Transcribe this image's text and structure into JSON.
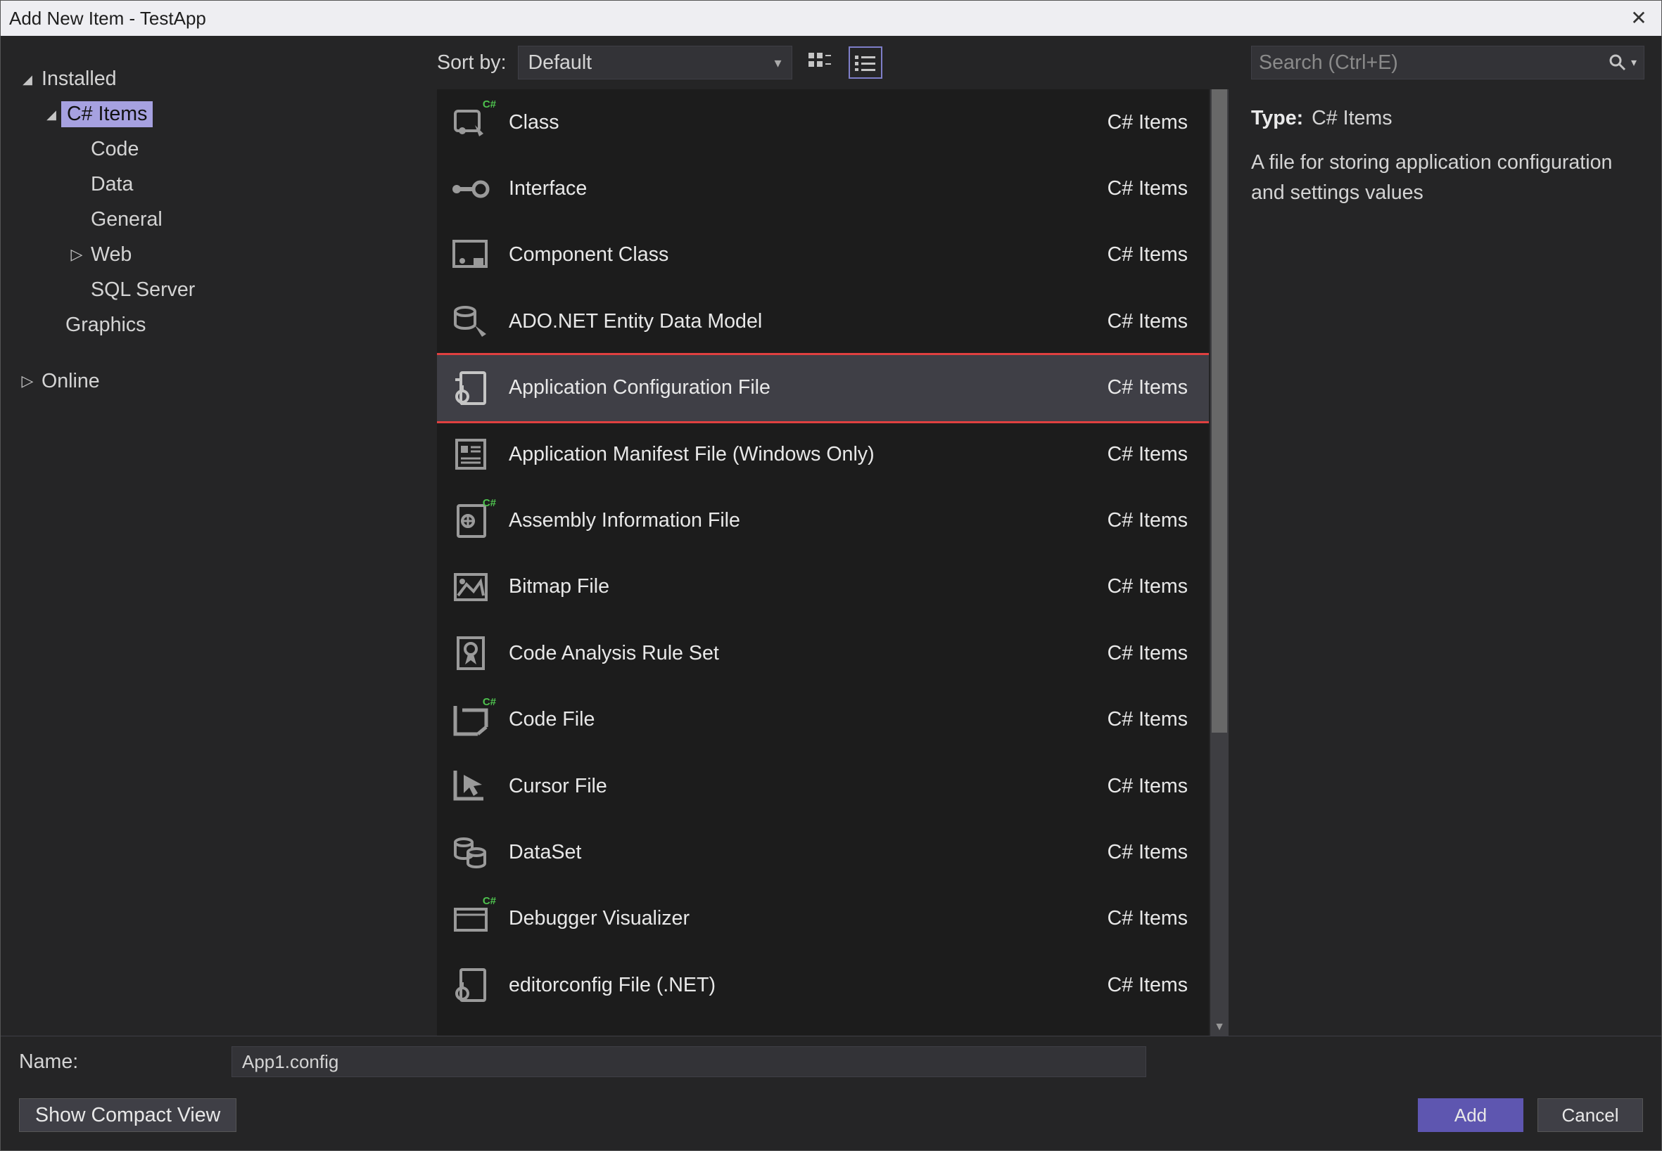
{
  "window": {
    "title": "Add New Item - TestApp"
  },
  "tree": {
    "root1": {
      "label": "Installed",
      "state": "expanded"
    },
    "csitems": {
      "label": "C# Items",
      "state": "expanded",
      "selected": true
    },
    "code": {
      "label": "Code"
    },
    "data": {
      "label": "Data"
    },
    "general": {
      "label": "General"
    },
    "web": {
      "label": "Web",
      "state": "collapsed"
    },
    "sql": {
      "label": "SQL Server"
    },
    "graphics": {
      "label": "Graphics"
    },
    "online": {
      "label": "Online",
      "state": "collapsed"
    }
  },
  "sort": {
    "label": "Sort by:",
    "value": "Default"
  },
  "items": [
    {
      "label": "Class",
      "category": "C# Items",
      "icon": "class",
      "tag": "C#"
    },
    {
      "label": "Interface",
      "category": "C# Items",
      "icon": "interface"
    },
    {
      "label": "Component Class",
      "category": "C# Items",
      "icon": "component"
    },
    {
      "label": "ADO.NET Entity Data Model",
      "category": "C# Items",
      "icon": "ado"
    },
    {
      "label": "Application Configuration File",
      "category": "C# Items",
      "icon": "config",
      "selected": true,
      "highlight": true
    },
    {
      "label": "Application Manifest File (Windows Only)",
      "category": "C# Items",
      "icon": "manifest"
    },
    {
      "label": "Assembly Information File",
      "category": "C# Items",
      "icon": "assembly",
      "tag": "C#"
    },
    {
      "label": "Bitmap File",
      "category": "C# Items",
      "icon": "bitmap"
    },
    {
      "label": "Code Analysis Rule Set",
      "category": "C# Items",
      "icon": "ruleset"
    },
    {
      "label": "Code File",
      "category": "C# Items",
      "icon": "codefile",
      "tag": "C#"
    },
    {
      "label": "Cursor File",
      "category": "C# Items",
      "icon": "cursor"
    },
    {
      "label": "DataSet",
      "category": "C# Items",
      "icon": "dataset"
    },
    {
      "label": "Debugger Visualizer",
      "category": "C# Items",
      "icon": "debugger",
      "tag": "C#"
    },
    {
      "label": "editorconfig File (.NET)",
      "category": "C# Items",
      "icon": "editorconfig"
    }
  ],
  "search": {
    "placeholder": "Search (Ctrl+E)"
  },
  "details": {
    "type_label": "Type:",
    "type_value": "C# Items",
    "description": "A file for storing application configuration and settings values"
  },
  "footer": {
    "name_label": "Name:",
    "name_value": "App1.config",
    "compact": "Show Compact View",
    "add": "Add",
    "cancel": "Cancel"
  }
}
